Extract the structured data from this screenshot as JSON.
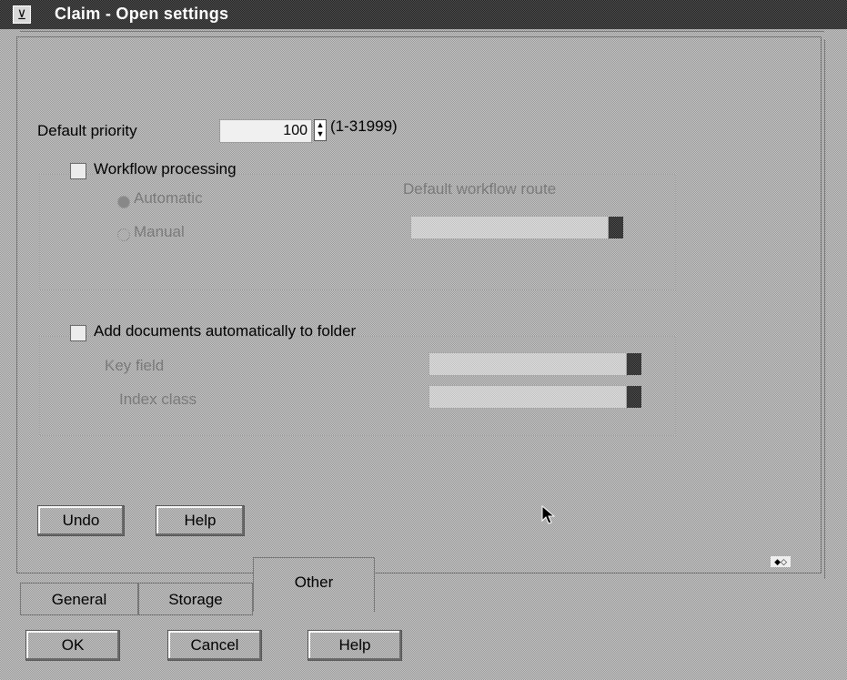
{
  "window": {
    "title": "Claim - Open settings",
    "sysmenu_glyph": "⊻"
  },
  "priority": {
    "label": "Default priority",
    "value": "100",
    "range": "(1-31999)"
  },
  "workflow": {
    "checkbox_label": "Workflow processing",
    "checked": false,
    "options": [
      {
        "label": "Automatic",
        "selected": true
      },
      {
        "label": "Manual",
        "selected": false
      }
    ],
    "route_label": "Default workflow route",
    "route_value": ""
  },
  "folder": {
    "checkbox_label": "Add documents automatically to folder",
    "checked": false,
    "key_field_label": "Key field",
    "key_field_value": "",
    "index_class_label": "Index class",
    "index_class_value": ""
  },
  "page_buttons": {
    "undo": "Undo",
    "help": "Help"
  },
  "tabs": [
    {
      "label": "General",
      "active": false
    },
    {
      "label": "Storage",
      "active": false
    },
    {
      "label": "Other",
      "active": true
    }
  ],
  "dialog_buttons": {
    "ok": "OK",
    "cancel": "Cancel",
    "help": "Help"
  }
}
